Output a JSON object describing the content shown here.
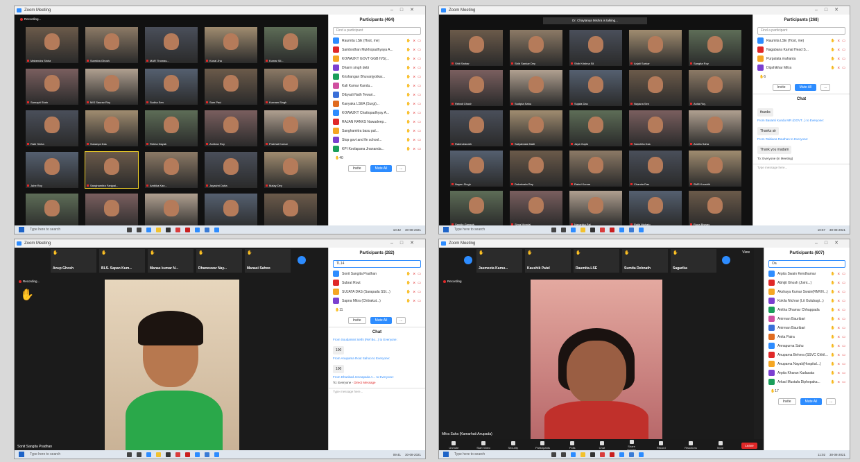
{
  "window_title": "Zoom Meeting",
  "q1": {
    "recording": "Recording...",
    "participants_title": "Participants (464)",
    "search_placeholder": "Find a participant",
    "participants": [
      "Raumita LSE (Host, me)",
      "Sambodhan Mukhopadhyaya A...",
      "KOWAZKT GOVT GGB H/S(...",
      "Dharm singh debi",
      "Krishangan Bhuvanjyotkar...",
      "Kali Kumar Kandu...",
      "Dibyadi Nath Tewari...",
      "Kanyaka LSEA (Surgi)...",
      "KOWAZKT Chattopadhyay A...",
      "RAJAN RANKS Nawadeep...",
      "Sanghamitra basu pal...",
      "Stop govt and fin school...",
      "KPI Koolapana Jnananda..."
    ],
    "count": "40",
    "invite": "Invite",
    "mute_all": "Mute All",
    "more": "...",
    "tiles": [
      "Mahendra Sinha",
      "Surekha Ghosh",
      "MAR Thomas...",
      "Kunal Jha",
      "Kumar Sil...",
      "Samapti Shah",
      "MIS Saurav Roy",
      "Sudha Sen",
      "Sam Paul",
      "Kurnam Singh",
      "Rabi Sinha",
      "Sukanya Das",
      "Rekha Nayak",
      "Anirban Roy",
      "Prabhat Kumar",
      "Jahe Roy",
      "Sanghamitra Fanjpal...",
      "Ambika Kan...",
      "Jayashri Dutta",
      "Malay Dey",
      "Mina Ghosh",
      "Bhagyashree Bal",
      "Arindam Saha",
      "Raghunath Mahato",
      "Satyanarayan"
    ],
    "start": "Type here to search",
    "clock": "10:42",
    "date": "30-08-2021"
  },
  "q2": {
    "talking": "Dr. Chaytanya Mishra is talking...",
    "participants_title": "Participants (268)",
    "search_placeholder": "Find a participant",
    "participants": [
      "Raumita LSE (Host, me)",
      "Nagabana Kamal Head S...",
      "Purpalata mahanta",
      "Dipshikhar Mitra"
    ],
    "count": "6",
    "invite": "Invite",
    "mute_all": "Mute All",
    "more": "...",
    "chat_title": "Chat",
    "chat": [
      {
        "from": "",
        "msg": "thanks"
      },
      {
        "from": "From Basanti Kundu MR (GOVT...) to Everyone:",
        "msg": "Thanks sir"
      },
      {
        "from": "From Rabiana Rauthan to Everyone:",
        "msg": "Thank you madam"
      }
    ],
    "to": "To: Everyone (in Meeting)",
    "type_msg": "Type message here...",
    "tiles": [
      "Shiti Sarkar",
      "Shib Sankar Dey",
      "Shib Krishna Sil",
      "Anjali Sarkar",
      "Sangita Roy",
      "Rebati Ghosh",
      "Sudipta Sahu",
      "Sujata Das",
      "Nayana Sen",
      "Anita Roy",
      "Rabindranath",
      "Satyabrata Maiti",
      "Jaya Gupta",
      "Sanchita Das",
      "Amrita Saha",
      "Nayan Singh",
      "Debabrata Ray",
      "Rahul Kumar",
      "Chanda Das",
      "SMS Koushik",
      "Sandip Ganguly",
      "Sima Mondal",
      "Nayanika Pal",
      "Rajib Mahato",
      "Rupa Biswas"
    ],
    "start": "Type here to search",
    "clock": "10:57",
    "date": "30-08-2021"
  },
  "q3": {
    "strip": [
      "Anup Ghosh",
      "BLS. Sapan Kum...",
      "Manas kumar N...",
      "Dhaneswar Nay...",
      "Manasi Sahoo"
    ],
    "recording": "Recording...",
    "speaker": "Sonit Sangita Pradhan",
    "participants_title": "Participants (282)",
    "search_value": "TL14",
    "participants": [
      "Sonit Sangita Pradhan",
      "Subrat Rout",
      "SUJATA DAS (Sarapada SSI...)",
      "Sapna Mitra (Chitrakut...)"
    ],
    "count": "11",
    "invite": "Invite",
    "mute_all": "Mute All",
    "more": "...",
    "chat_title": "Chat",
    "chat": [
      {
        "from": "From Soudamini Sethi (Ref Bo...) to Everyone:",
        "msg": "100"
      },
      {
        "from": "From Anupama Rout Sahoo to Everyone:",
        "msg": "100"
      },
      {
        "from": "From Dhanbad Jennapada A... to Everyone:",
        "msg": ""
      }
    ],
    "to": "To: Everyone",
    "direct": "Direct Message",
    "type_msg": "Type message here...",
    "start": "Type here to search",
    "clock": "09:41",
    "date": "30-08-2021"
  },
  "q4": {
    "strip": [
      "Jasmeeta Kamu...",
      "Kaushik Patel",
      "Raumita-LSE",
      "Sumita Debnath",
      "Sagarika"
    ],
    "recording": "Recording",
    "view": "View",
    "speaker": "Mitra Saha (Kamarhati Anupada)",
    "participants_title": "Participants (607)",
    "search_value": "Oa",
    "participants": [
      "Arpita Swain Kendhamar",
      "Abhijit Ghosh (Joint...)",
      "Akshaya Kumar Swain(RMVN...)",
      "Kokila Nichrar (Lit Gulubagi...)",
      "Anitha Dhamar Chhappada",
      "Anirman Bauribari",
      "Anirman Bauribari",
      "Anita Patra",
      "Annapurna Sahu",
      "Anupama Behera (SSVC Chhila...)",
      "Anupama Nayak(Hospital...)",
      "Arpita Kharan Kadasata",
      "Arkad Mustafa Diphopaka..."
    ],
    "count": "17",
    "invite": "Invite",
    "mute_all": "Mute All",
    "more": "...",
    "tools": [
      "Unmute",
      "Start Video",
      "Security",
      "Participants",
      "Polls",
      "Chat",
      "Share Screen",
      "Record",
      "Reactions",
      "More"
    ],
    "end": "Leave",
    "start": "Type here to search",
    "clock": "11:02",
    "date": "30-08-2021"
  },
  "colors": {
    "zoom_blue": "#2d8cff",
    "muted_red": "#e02828",
    "hand": "#f5a623",
    "dark": "#1e1e1e"
  }
}
